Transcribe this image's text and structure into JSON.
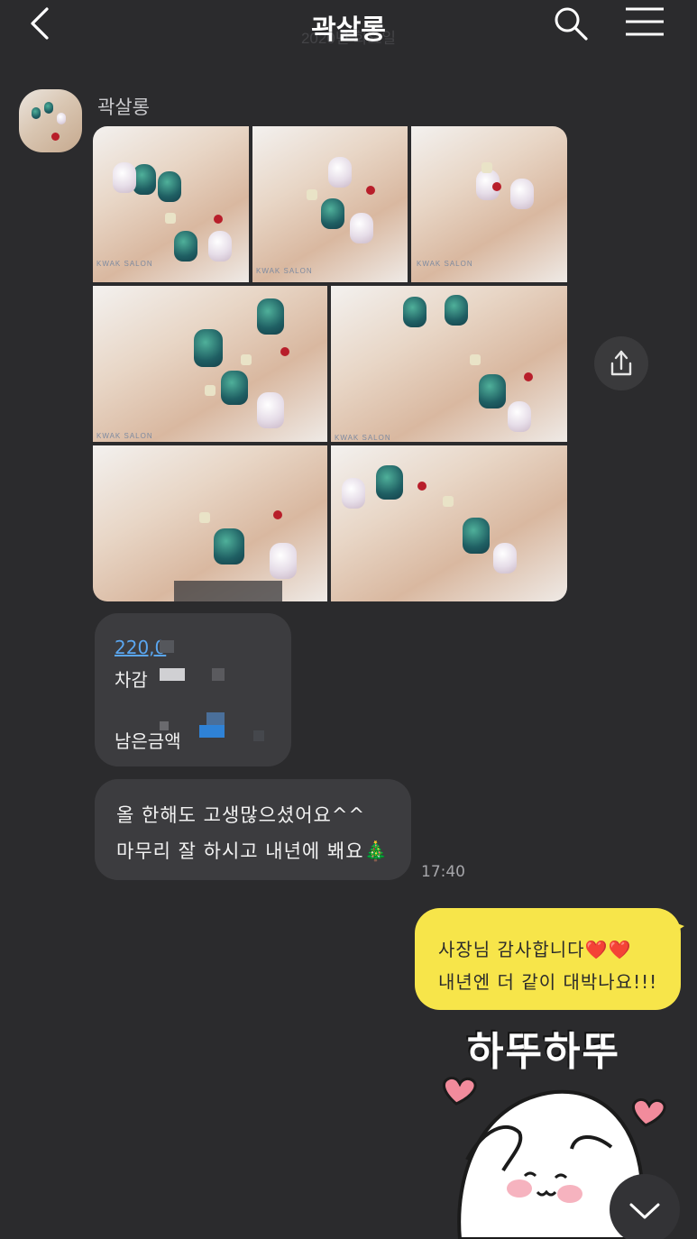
{
  "header": {
    "title": "곽살롱",
    "date_ghost": "2020년 화요일",
    "back_icon": "chevron-left-icon",
    "search_icon": "search-icon",
    "menu_icon": "hamburger-menu-icon"
  },
  "chat": {
    "sender_name": "곽살롱",
    "photo_watermark": "KWAK SALON",
    "price_bubble": {
      "line1": "220,0",
      "line2": "차감",
      "line3": "남은금액"
    },
    "message": {
      "line1": "올 한해도 고생많으셨어요^^",
      "line2": "마무리 잘 하시고 내년에 봬요🎄",
      "time": "17:40"
    },
    "my_message": {
      "line1": "사장님 감사합니다❤️❤️",
      "line2": "내년엔 더 같이 대박나요!!!"
    },
    "sticker_text": "하뚜하뚜"
  },
  "colors": {
    "background": "#2b2b2d",
    "bubble_received": "#3c3c3f",
    "bubble_sent": "#f7e54a",
    "link": "#5aa6f0"
  }
}
